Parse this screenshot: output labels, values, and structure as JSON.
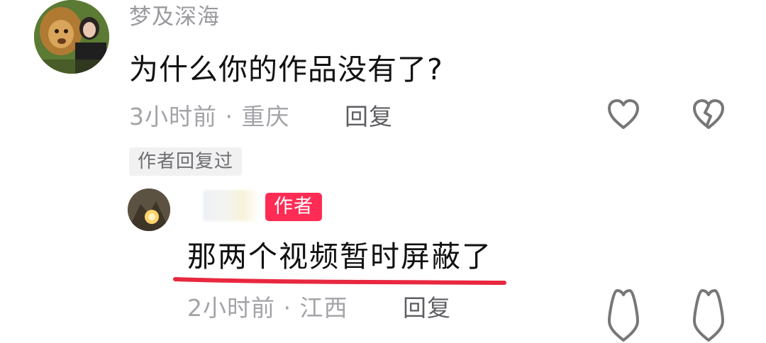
{
  "comment": {
    "username": "梦及深海",
    "text": "为什么你的作品没有了?",
    "meta": "3小时前 · 重庆",
    "reply_label": "回复",
    "author_replied_badge": "作者回复过",
    "like_icon": "heart-outline-icon",
    "dislike_icon": "broken-heart-icon"
  },
  "reply": {
    "author_tag": "作者",
    "text": "那两个视频暂时屏蔽了",
    "meta": "2小时前 · 江西",
    "reply_label": "回复",
    "like_icon": "heart-outline-icon",
    "dislike_icon": "broken-heart-icon",
    "underline_color": "#e8283f"
  },
  "colors": {
    "author_tag_bg": "#fe2c55",
    "meta_text": "#a3a3a8",
    "username_text": "#9a9a9f"
  }
}
